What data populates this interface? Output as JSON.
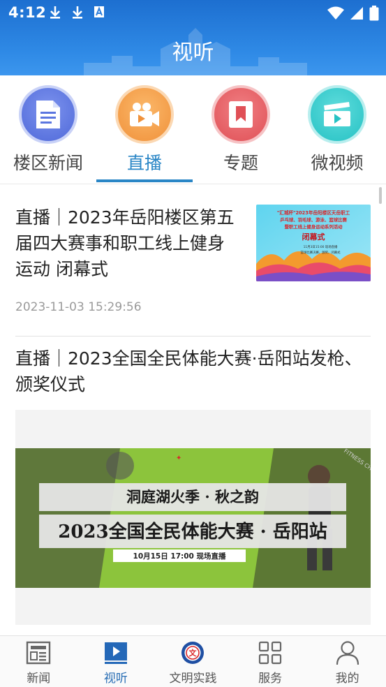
{
  "status_bar": {
    "time": "4:12"
  },
  "header": {
    "title": "视听"
  },
  "categories": [
    {
      "label": "楼区新闻",
      "icon": "news-document-icon",
      "color": "#5b76e0"
    },
    {
      "label": "直播",
      "icon": "video-camera-icon",
      "color": "#f5a04a",
      "active": true
    },
    {
      "label": "专题",
      "icon": "bookmark-icon",
      "color": "#e96166"
    },
    {
      "label": "微视频",
      "icon": "clapperboard-icon",
      "color": "#3fcfd0"
    }
  ],
  "feed": {
    "items": [
      {
        "title": "直播｜2023年岳阳楼区第五届四大赛事和职工线上健身运动 闭幕式",
        "timestamp": "2023-11-03 15:29:56",
        "thumbnail": {
          "line1": "\"汇城杯\"2023年岳阳楼区天岳职工",
          "line2": "乒乓球、羽毛球、游泳、篮球比赛",
          "line3": "暨职工线上健身运动系列活动",
          "banner": "闭幕式",
          "small1": "11月3日15:00 现场直播",
          "small2": "篮球比赛决赛、颁奖、闭幕式"
        }
      },
      {
        "title": "直播｜2023全国全民体能大赛·岳阳站发枪、颁奖仪式",
        "image": {
          "line1": "洞庭湖火季 · 秋之韵",
          "line2": "2023全国全民体能大赛 · 岳阳站",
          "line3": "10月15日 17:00 现场直播",
          "side_text": "FITNESS CH"
        }
      }
    ]
  },
  "bottom_nav": [
    {
      "label": "新闻",
      "icon": "newspaper-icon"
    },
    {
      "label": "视听",
      "icon": "play-video-icon",
      "active": true
    },
    {
      "label": "文明实践",
      "icon": "civilization-emblem-icon"
    },
    {
      "label": "服务",
      "icon": "grid-apps-icon"
    },
    {
      "label": "我的",
      "icon": "user-profile-icon"
    }
  ]
}
